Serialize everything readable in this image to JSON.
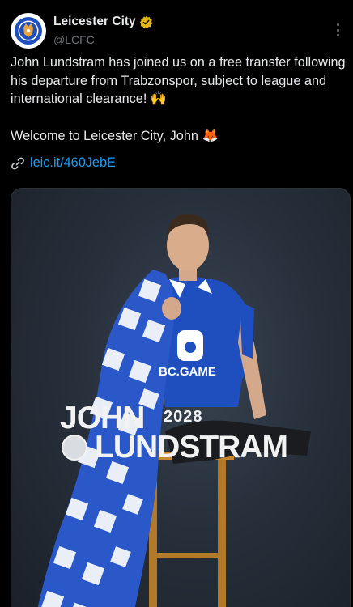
{
  "account": {
    "display_name": "Leicester City",
    "handle": "@LCFC",
    "verified_icon": "gold-verified-badge-icon",
    "avatar_icon": "leicester-city-crest-icon"
  },
  "post": {
    "paragraph1": "John Lundstram has joined us on a free transfer following his departure from Trabzonspor, subject to league and international clearance! 🙌",
    "paragraph2": "Welcome to Leicester City, John 🦊",
    "link_text": "leic.it/460JebE",
    "link_icon": "link-icon"
  },
  "media": {
    "first_name": "JOHN",
    "year": "2028",
    "last_name": "LUNDSTRAM",
    "sponsor": "BC.GAME"
  },
  "colors": {
    "background": "#000000",
    "text": "#e7e9ea",
    "muted": "#71767b",
    "link": "#1d9bf0",
    "verified_gold": "#e2b719",
    "kit_blue": "#1f4fbf"
  }
}
